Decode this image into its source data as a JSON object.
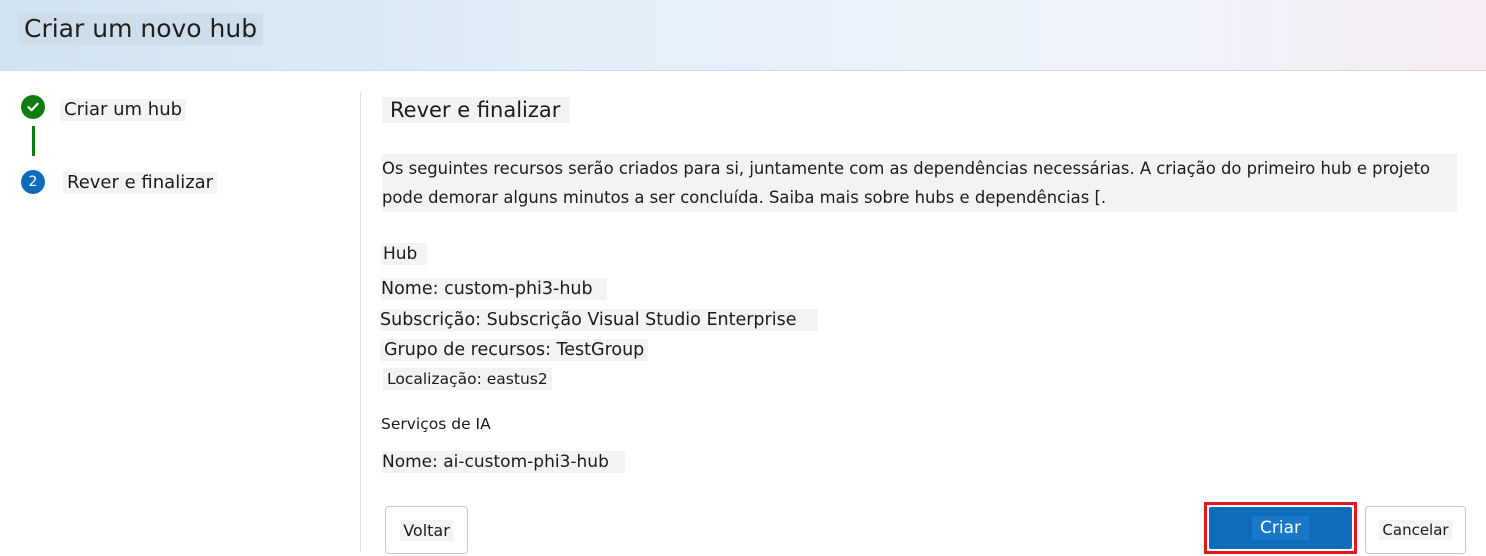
{
  "header": {
    "title": "Criar um novo hub"
  },
  "stepper": {
    "steps": [
      {
        "label": "Criar um hub",
        "status": "completed",
        "icon": "checkmark-icon"
      },
      {
        "label": "Rever e finalizar",
        "status": "current",
        "number": "2"
      }
    ]
  },
  "main": {
    "title": "Rever e finalizar",
    "description": "Os seguintes recursos serão criados para si, juntamente com as dependências necessárias. A criação do primeiro hub e projeto pode demorar alguns minutos a ser concluída. Saiba mais sobre hubs e dependências [.",
    "hub": {
      "heading": "Hub",
      "name": "Nome: custom-phi3-hub",
      "subscription": "Subscrição: Subscrição Visual Studio Enterprise",
      "resource_group": "Grupo de recursos: TestGroup",
      "location": "Localização: eastus2"
    },
    "ai_services": {
      "heading": "Serviços de IA",
      "name": "Nome: ai-custom-phi3-hub"
    }
  },
  "footer": {
    "back_label": "Voltar",
    "create_label": "Criar",
    "cancel_label": "Cancelar"
  },
  "colors": {
    "primary": "#0f6cbd",
    "success": "#107c10",
    "highlight_border": "#e3171d"
  }
}
